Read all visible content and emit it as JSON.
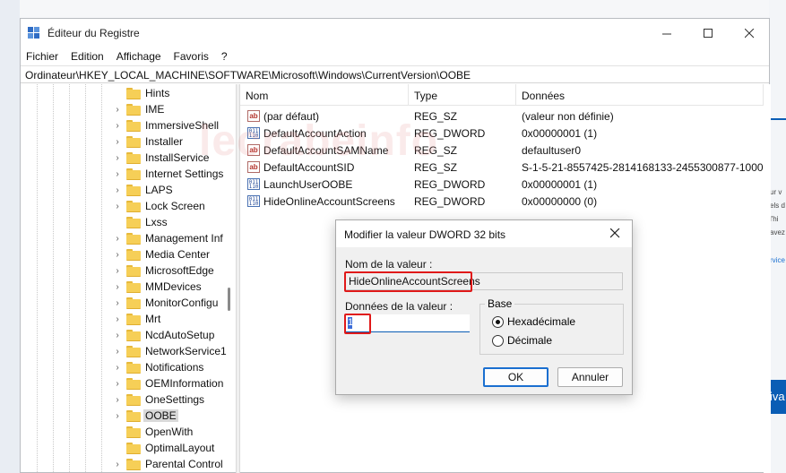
{
  "window": {
    "title": "Éditeur du Registre",
    "controls": [
      "minimize",
      "maximize",
      "close"
    ]
  },
  "menu": [
    "Fichier",
    "Edition",
    "Affichage",
    "Favoris",
    "?"
  ],
  "address": "Ordinateur\\HKEY_LOCAL_MACHINE\\SOFTWARE\\Microsoft\\Windows\\CurrentVersion\\OOBE",
  "tree": {
    "items": [
      {
        "label": "Hints",
        "expandable": false
      },
      {
        "label": "IME",
        "expandable": true
      },
      {
        "label": "ImmersiveShell",
        "expandable": true
      },
      {
        "label": "Installer",
        "expandable": true
      },
      {
        "label": "InstallService",
        "expandable": true
      },
      {
        "label": "Internet Settings",
        "expandable": true
      },
      {
        "label": "LAPS",
        "expandable": true
      },
      {
        "label": "Lock Screen",
        "expandable": true
      },
      {
        "label": "Lxss",
        "expandable": false
      },
      {
        "label": "Management Inf",
        "expandable": true
      },
      {
        "label": "Media Center",
        "expandable": true
      },
      {
        "label": "MicrosoftEdge",
        "expandable": true
      },
      {
        "label": "MMDevices",
        "expandable": true
      },
      {
        "label": "MonitorConfigu",
        "expandable": true
      },
      {
        "label": "Mrt",
        "expandable": true
      },
      {
        "label": "NcdAutoSetup",
        "expandable": true
      },
      {
        "label": "NetworkService1",
        "expandable": true
      },
      {
        "label": "Notifications",
        "expandable": true
      },
      {
        "label": "OEMInformation",
        "expandable": true
      },
      {
        "label": "OneSettings",
        "expandable": true
      },
      {
        "label": "OOBE",
        "expandable": true,
        "selected": true
      },
      {
        "label": "OpenWith",
        "expandable": false
      },
      {
        "label": "OptimalLayout",
        "expandable": false
      },
      {
        "label": "Parental Control",
        "expandable": true
      }
    ]
  },
  "values": {
    "headers": {
      "name": "Nom",
      "type": "Type",
      "data": "Données"
    },
    "rows": [
      {
        "icon": "string-value-icon",
        "name": "(par défaut)",
        "type": "REG_SZ",
        "data": "(valeur non définie)"
      },
      {
        "icon": "binary-value-icon",
        "name": "DefaultAccountAction",
        "type": "REG_DWORD",
        "data": "0x00000001 (1)"
      },
      {
        "icon": "string-value-icon",
        "name": "DefaultAccountSAMName",
        "type": "REG_SZ",
        "data": "defaultuser0"
      },
      {
        "icon": "string-value-icon",
        "name": "DefaultAccountSID",
        "type": "REG_SZ",
        "data": "S-1-5-21-8557425-2814168133-2455300877-1000"
      },
      {
        "icon": "binary-value-icon",
        "name": "LaunchUserOOBE",
        "type": "REG_DWORD",
        "data": "0x00000001 (1)"
      },
      {
        "icon": "binary-value-icon",
        "name": "HideOnlineAccountScreens",
        "type": "REG_DWORD",
        "data": "0x00000000 (0)"
      }
    ]
  },
  "watermark": "lecrabeinfo",
  "dialog": {
    "title": "Modifier la valeur DWORD 32 bits",
    "name_label": "Nom de la valeur :",
    "name_value": "HideOnlineAccountScreens",
    "data_label": "Données de la valeur :",
    "data_value": "1",
    "base_label": "Base",
    "radio_hex": "Hexadécimale",
    "radio_dec": "Décimale",
    "selected_base": "Hexadécimale",
    "ok_label": "OK",
    "cancel_label": "Annuler",
    "highlight_color": "#e01919"
  },
  "background": {
    "right_texts": [
      "ur v",
      "els d",
      "l'hi",
      "avez"
    ],
    "right_link": "rvice",
    "right_button": "iva"
  }
}
